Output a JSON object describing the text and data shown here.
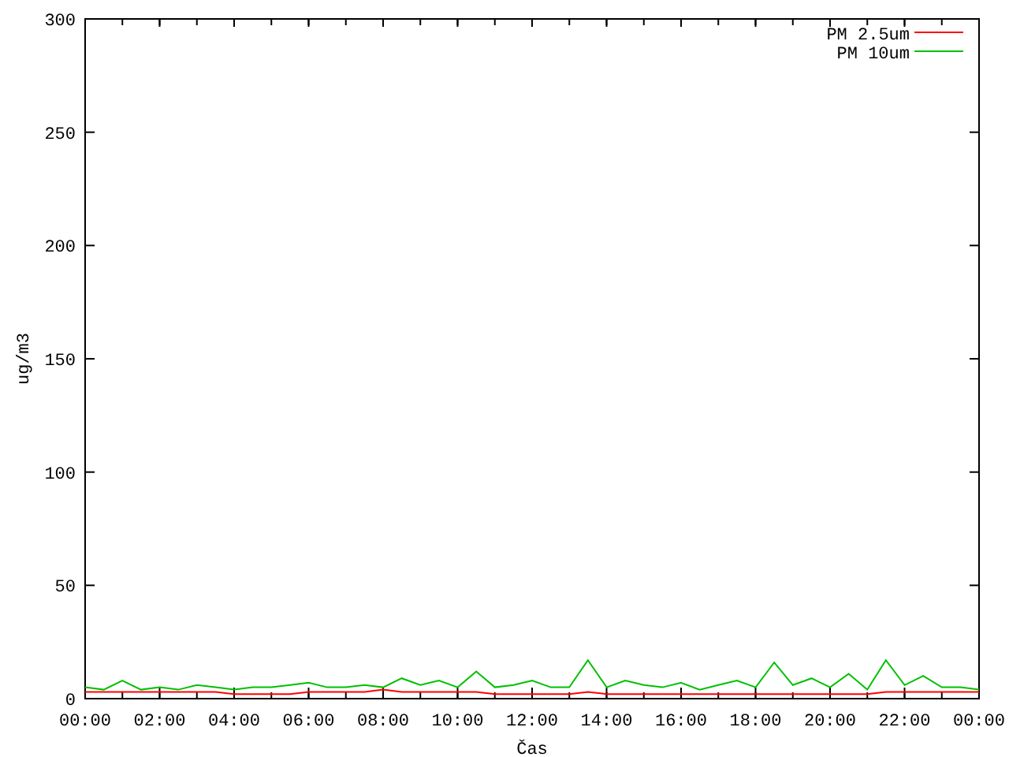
{
  "chart": {
    "chart_data": {
      "type": "line",
      "xlabel": "Čas",
      "ylabel": "ug/m3",
      "x": [
        0,
        0.5,
        1,
        1.5,
        2,
        2.5,
        3,
        3.5,
        4,
        4.5,
        5,
        5.5,
        6,
        6.5,
        7,
        7.5,
        8,
        8.5,
        9,
        9.5,
        10,
        10.5,
        11,
        11.5,
        12,
        12.5,
        13,
        13.5,
        14,
        14.5,
        15,
        15.5,
        16,
        16.5,
        17,
        17.5,
        18,
        18.5,
        19,
        19.5,
        20,
        20.5,
        21,
        21.5,
        22,
        22.5,
        23,
        23.5,
        24
      ],
      "series": [
        {
          "name": "PM 2.5um",
          "color": "#ff0000",
          "values": [
            3,
            3,
            3,
            3,
            3,
            3,
            3,
            3,
            2,
            2,
            2,
            2,
            3,
            3,
            3,
            3,
            4,
            3,
            3,
            3,
            3,
            3,
            2,
            2,
            2,
            2,
            2,
            3,
            2,
            2,
            2,
            2,
            2,
            2,
            2,
            2,
            2,
            2,
            2,
            2,
            2,
            2,
            2,
            3,
            3,
            3,
            3,
            3,
            3
          ]
        },
        {
          "name": "PM 10um",
          "color": "#00c000",
          "values": [
            5,
            4,
            8,
            4,
            5,
            4,
            6,
            5,
            4,
            5,
            5,
            6,
            7,
            5,
            5,
            6,
            5,
            9,
            6,
            8,
            5,
            12,
            5,
            6,
            8,
            5,
            5,
            17,
            5,
            8,
            6,
            5,
            7,
            4,
            6,
            8,
            5,
            16,
            6,
            9,
            5,
            11,
            4,
            17,
            6,
            10,
            5,
            5,
            4
          ]
        }
      ],
      "legend": "upper right",
      "xlim": [
        0,
        24
      ],
      "ylim": [
        0,
        300
      ],
      "xticks": [
        {
          "value": 0,
          "label": "00:00"
        },
        {
          "value": 2,
          "label": "02:00"
        },
        {
          "value": 4,
          "label": "04:00"
        },
        {
          "value": 6,
          "label": "06:00"
        },
        {
          "value": 8,
          "label": "08:00"
        },
        {
          "value": 10,
          "label": "10:00"
        },
        {
          "value": 12,
          "label": "12:00"
        },
        {
          "value": 14,
          "label": "14:00"
        },
        {
          "value": 16,
          "label": "16:00"
        },
        {
          "value": 18,
          "label": "18:00"
        },
        {
          "value": 20,
          "label": "20:00"
        },
        {
          "value": 22,
          "label": "22:00"
        },
        {
          "value": 24,
          "label": "00:00"
        }
      ],
      "yticks": [
        0,
        50,
        100,
        150,
        200,
        250,
        300
      ]
    }
  }
}
